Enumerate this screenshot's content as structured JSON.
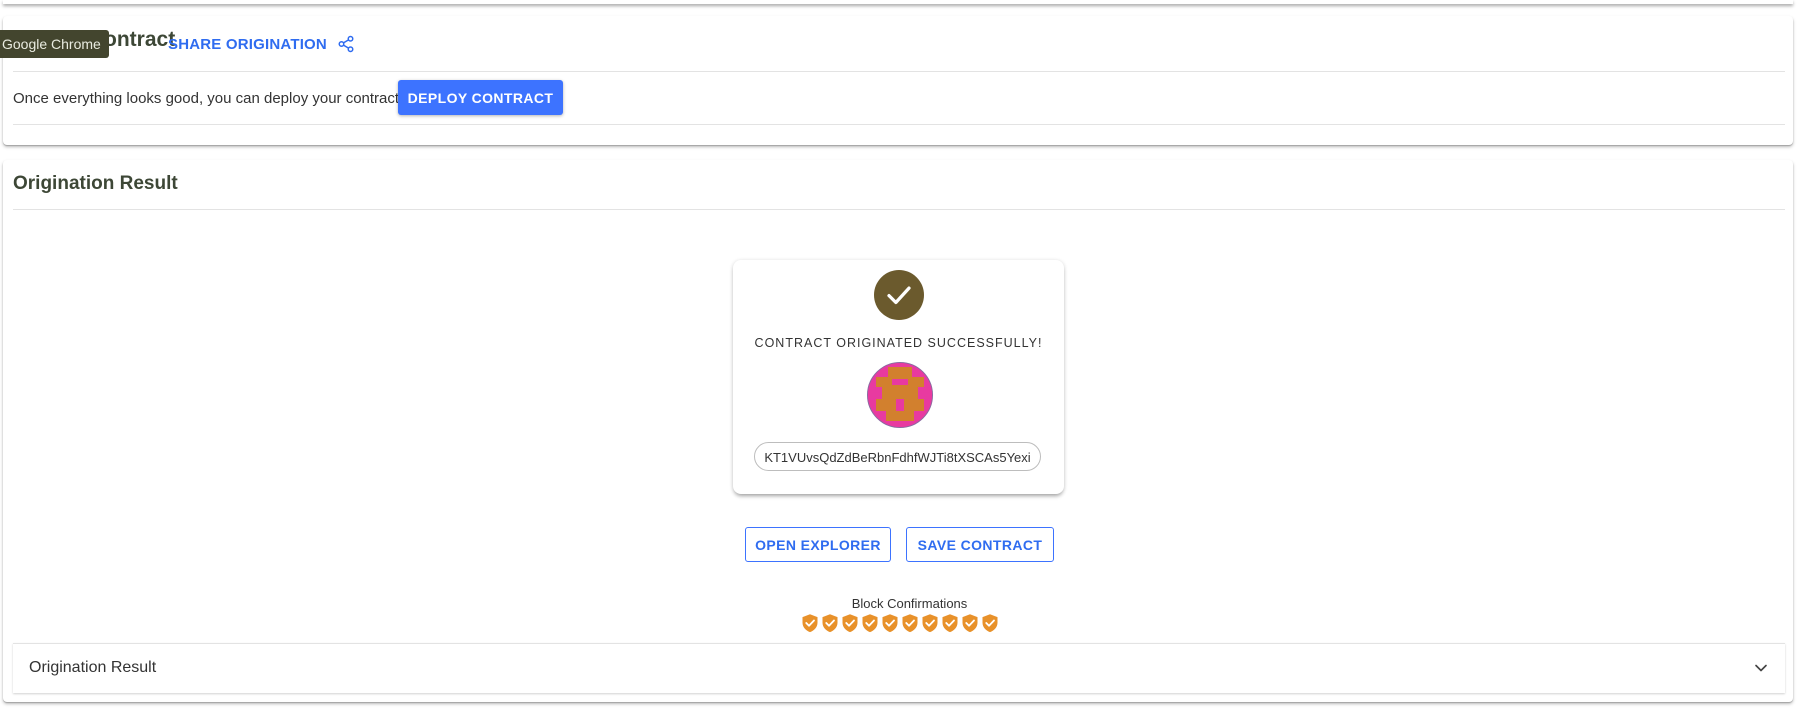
{
  "tooltip": {
    "text": "Google Chrome"
  },
  "deploy_section": {
    "title": "Deploy Contract",
    "share_label": "SHARE ORIGINATION",
    "instruction": "Once everything looks good, you can deploy your contract:",
    "deploy_button": "DEPLOY CONTRACT"
  },
  "result_section": {
    "title": "Origination Result",
    "success_message": "CONTRACT ORIGINATED SUCCESSFULLY!",
    "contract_address": "KT1VUvsQdZdBeRbnFdhfWJTi8tXSCAs5Yexi",
    "open_explorer_button": "OPEN EXPLORER",
    "save_contract_button": "SAVE CONTRACT",
    "block_confirmations_label": "Block Confirmations",
    "block_confirmations_count": 10,
    "accordion_title": "Origination Result"
  },
  "colors": {
    "accent": "#3d73ff",
    "title": "#3d4736",
    "check_badge": "#6b5a2d",
    "shield": "#e8912a"
  },
  "icons": {
    "share": "share-icon",
    "check": "check-circle-icon",
    "shield": "shield-check-icon",
    "chevron": "chevron-down-icon"
  }
}
